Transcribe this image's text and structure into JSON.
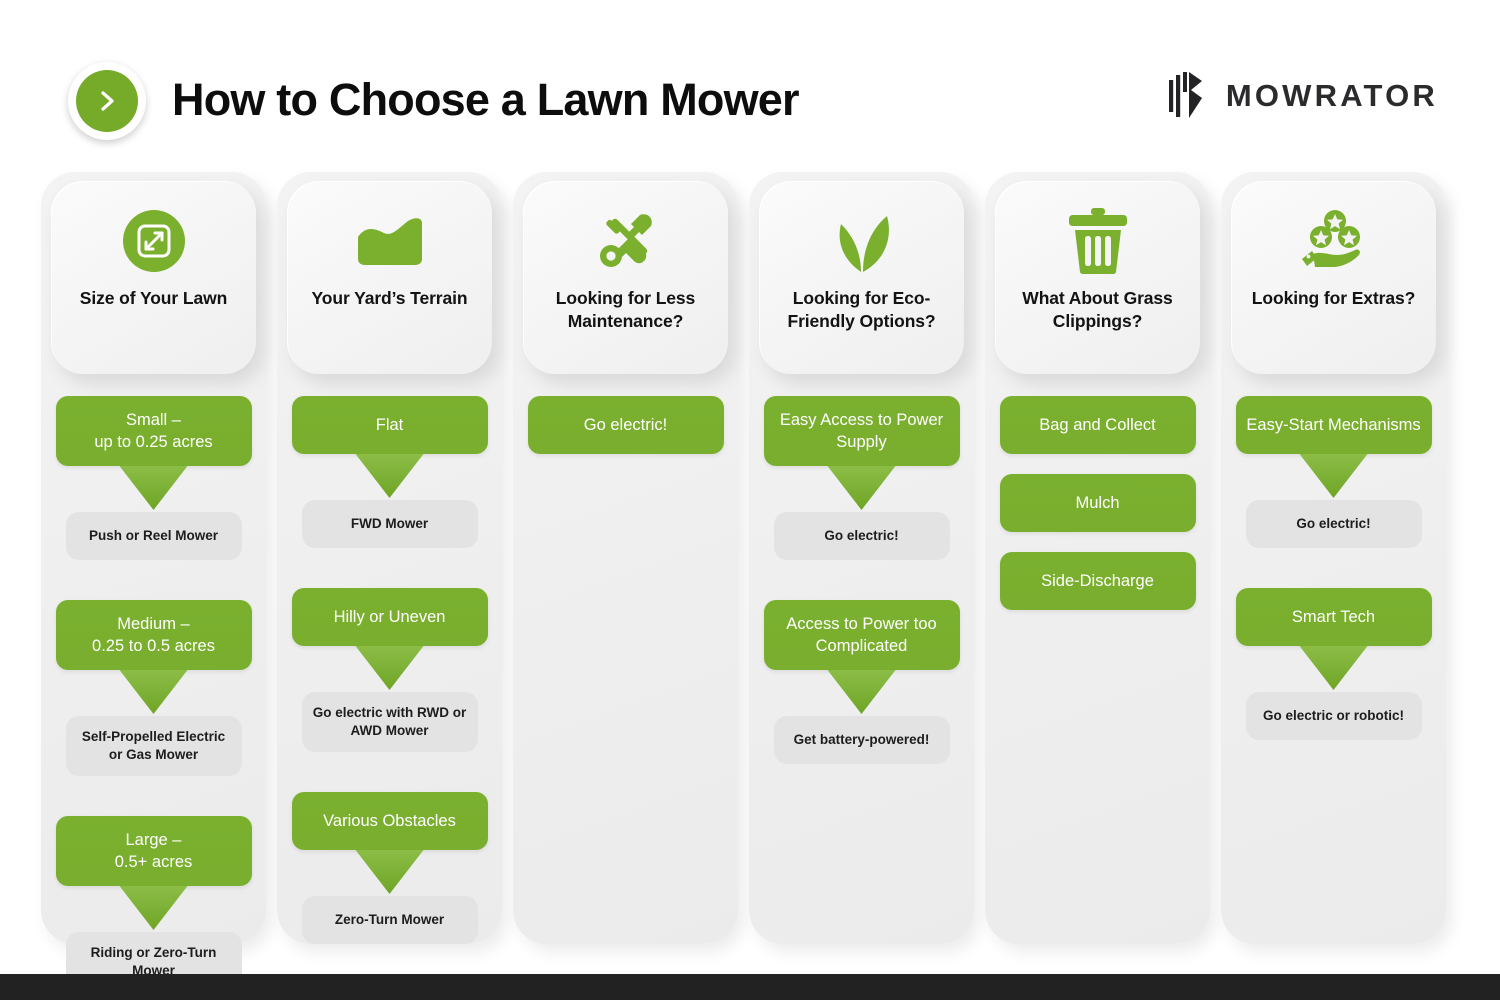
{
  "header": {
    "chevron_icon": "chevron-right-icon",
    "title": "How to Choose a Lawn Mower",
    "brand_name": "MOWRATOR",
    "brand_mark_icon": "mowrator-logo-mark"
  },
  "colors": {
    "green": "#7AB02E",
    "green_arrow_light": "#8CBD47",
    "card_gray": "#EFEFEF",
    "chip_gray": "#E3E3E3",
    "title_black": "#0D0D0D",
    "footer_bar": "#222223"
  },
  "columns": [
    {
      "icon": "expand-arrows-in-square-icon",
      "title": "Size of Your Lawn",
      "groups": [
        {
          "green": "Small –\nup to 0.25 acres",
          "arrow": true,
          "gray": "Push or Reel Mower"
        },
        {
          "green": "Medium –\n0.25 to 0.5 acres",
          "arrow": true,
          "gray": "Self-Propelled Electric or Gas Mower"
        },
        {
          "green": "Large –\n0.5+ acres",
          "arrow": true,
          "gray": "Riding or Zero-Turn Mower"
        }
      ]
    },
    {
      "icon": "terrain-hill-icon",
      "title": "Your Yard’s Terrain",
      "groups": [
        {
          "green": "Flat",
          "arrow": true,
          "gray": "FWD Mower"
        },
        {
          "green": "Hilly or Uneven",
          "arrow": true,
          "gray": "Go electric with RWD or AWD Mower"
        },
        {
          "green": "Various Obstacles",
          "arrow": true,
          "gray": "Zero-Turn Mower"
        }
      ]
    },
    {
      "icon": "wrench-screwdriver-icon",
      "title": "Looking for Less Maintenance?",
      "groups": [
        {
          "green": "Go electric!",
          "arrow": false,
          "gray": null
        }
      ]
    },
    {
      "icon": "leaves-icon",
      "title": "Looking for Eco-Friendly Options?",
      "groups": [
        {
          "green": "Easy Access to Power Supply",
          "arrow": true,
          "gray": "Go electric!"
        },
        {
          "green": "Access to Power too Complicated",
          "arrow": true,
          "gray": "Get battery-powered!"
        }
      ]
    },
    {
      "icon": "trash-can-icon",
      "title": "What About Grass Clippings?",
      "groups": [
        {
          "green": "Bag and Collect",
          "arrow": false,
          "gray": null
        },
        {
          "green": "Mulch",
          "arrow": false,
          "gray": null
        },
        {
          "green": "Side-Discharge",
          "arrow": false,
          "gray": null
        }
      ]
    },
    {
      "icon": "hand-holding-stars-icon",
      "title": "Looking for Extras?",
      "groups": [
        {
          "green": "Easy-Start Mechanisms",
          "arrow": true,
          "gray": "Go electric!"
        },
        {
          "green": "Smart Tech",
          "arrow": true,
          "gray": "Go electric or robotic!"
        }
      ]
    }
  ]
}
